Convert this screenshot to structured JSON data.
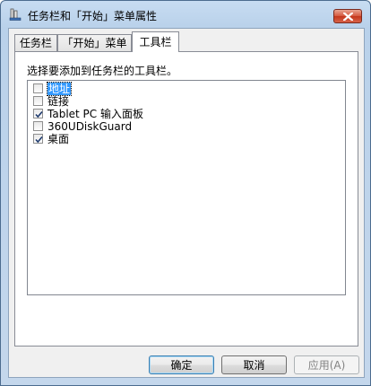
{
  "window": {
    "title": "任务栏和「开始」菜单属性"
  },
  "tabs": [
    {
      "label": "任务栏",
      "active": false
    },
    {
      "label": "「开始」菜单",
      "active": false
    },
    {
      "label": "工具栏",
      "active": true
    }
  ],
  "toolbars_panel": {
    "prompt": "选择要添加到任务栏的工具栏。",
    "items": [
      {
        "label": "地址",
        "checked": false,
        "focused": true
      },
      {
        "label": "链接",
        "checked": false,
        "focused": false
      },
      {
        "label": "Tablet PC 输入面板",
        "checked": true,
        "focused": false
      },
      {
        "label": "360UDiskGuard",
        "checked": false,
        "focused": false
      },
      {
        "label": "桌面",
        "checked": true,
        "focused": false
      }
    ]
  },
  "buttons": {
    "ok": "确定",
    "cancel": "取消",
    "apply": "应用(A)"
  },
  "colors": {
    "title_bar": "#b9d1ea",
    "close_button": "#c3361b",
    "selection": "#3399ff"
  }
}
